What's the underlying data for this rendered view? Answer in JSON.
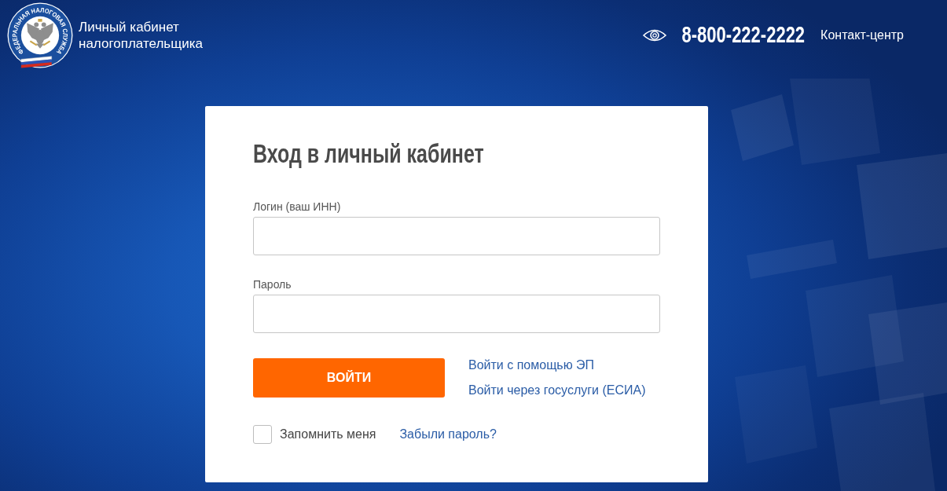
{
  "header": {
    "logo": {
      "ring_text": "ФЕДЕРАЛЬНАЯ НАЛОГОВАЯ СЛУЖБА"
    },
    "title": "Личный кабинет налогоплательщика",
    "phone": "8-800-222-2222",
    "contact_link": "Контакт-центр"
  },
  "login_form": {
    "title": "Вход в личный кабинет",
    "fields": [
      {
        "label": "Логин (ваш ИНН)"
      },
      {
        "label": "Пароль"
      }
    ],
    "submit_button": "ВОЙТИ",
    "alt_links": [
      "Войти с помощью ЭП",
      "Войти через госуслуги (ЕСИА)"
    ],
    "remember": {
      "label": "Запомнить меня",
      "checked": false
    },
    "forgot_link": "Забыли пароль?"
  }
}
